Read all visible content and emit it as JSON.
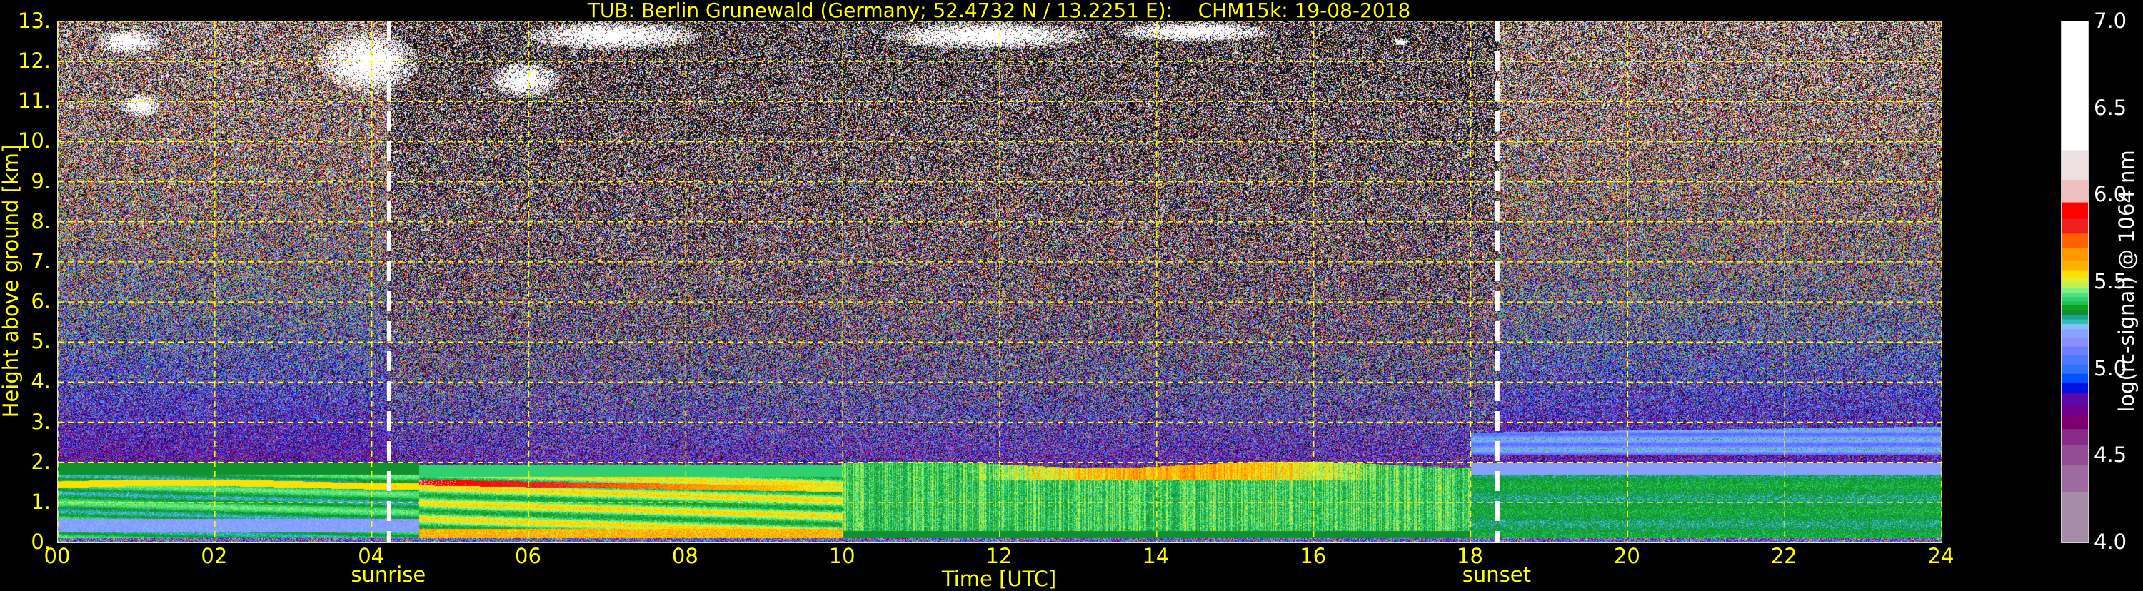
{
  "title": "TUB: Berlin Grunewald (Germany; 52.4732 N / 13.2251 E):    CHM15k: 19-08-2018",
  "chart_data": {
    "type": "heatmap",
    "title": "TUB: Berlin Grunewald (Germany; 52.4732 N / 13.2251 E):    CHM15k: 19-08-2018",
    "xlabel": "Time [UTC]",
    "ylabel": "Height above ground [km]",
    "xlim": [
      0,
      24
    ],
    "ylim": [
      0,
      13
    ],
    "xticks": [
      0,
      2,
      4,
      6,
      8,
      10,
      12,
      14,
      16,
      18,
      20,
      22,
      24
    ],
    "xtick_labels": [
      "00",
      "02",
      "04",
      "06",
      "08",
      "10",
      "12",
      "14",
      "16",
      "18",
      "20",
      "22",
      "24"
    ],
    "yticks": [
      0,
      1,
      2,
      3,
      4,
      5,
      6,
      7,
      8,
      9,
      10,
      11,
      12,
      13
    ],
    "ytick_labels": [
      "0.",
      "1.",
      "2.",
      "3.",
      "4.",
      "5.",
      "6.",
      "7.",
      "8.",
      "9.",
      "10.",
      "11.",
      "12.",
      "13."
    ],
    "grid": true,
    "annotations": [
      {
        "label": "sunrise",
        "time": 4.22
      },
      {
        "label": "sunset",
        "time": 18.34
      }
    ],
    "cirrus_patches": [
      {
        "t": [
          0.5,
          1.3
        ],
        "h": [
          12.2,
          12.8
        ]
      },
      {
        "t": [
          0.8,
          1.3
        ],
        "h": [
          10.6,
          11.2
        ]
      },
      {
        "t": [
          3.3,
          4.6
        ],
        "h": [
          11.2,
          12.8
        ]
      },
      {
        "t": [
          5.5,
          6.4
        ],
        "h": [
          11.1,
          12.0
        ]
      },
      {
        "t": [
          5.9,
          8.2
        ],
        "h": [
          12.3,
          13.0
        ]
      },
      {
        "t": [
          10.5,
          13.2
        ],
        "h": [
          12.3,
          13.0
        ]
      },
      {
        "t": [
          13.5,
          15.5
        ],
        "h": [
          12.5,
          13.0
        ]
      },
      {
        "t": [
          17.0,
          17.2
        ],
        "h": [
          12.4,
          12.6
        ]
      }
    ],
    "colorbar": {
      "label": "log(rc-signal) @ 1064 nm",
      "range": [
        4.0,
        7.0
      ],
      "ticks": [
        "4.0",
        "4.5",
        "5.0",
        "5.5",
        "6.0",
        "6.5",
        "7.0"
      ],
      "bounds": [
        4.0,
        4.29,
        4.445,
        4.564,
        4.655,
        4.733,
        4.795,
        4.86,
        4.923,
        4.973,
        5.027,
        5.08,
        5.13,
        5.18,
        5.23,
        5.26,
        5.286,
        5.31,
        5.34,
        5.37,
        5.39,
        5.416,
        5.44,
        5.465,
        5.5,
        5.53,
        5.57,
        5.625,
        5.697,
        5.78,
        5.865,
        5.96,
        6.09,
        6.26,
        7.0
      ],
      "colors": [
        "#a78ca8",
        "#9e6ba0",
        "#944c94",
        "#882a88",
        "#7c0070",
        "#700090",
        "#5a0aa8",
        "#0010e0",
        "#0050ff",
        "#3070ff",
        "#5078ff",
        "#6c80ff",
        "#8c90ff",
        "#88a0ff",
        "#80c0ff",
        "#30c0b0",
        "#20a090",
        "#109030",
        "#10a020",
        "#20c050",
        "#30d070",
        "#50e080",
        "#80f080",
        "#c0f050",
        "#e0f030",
        "#ffe000",
        "#ffb000",
        "#ff9800",
        "#ff6000",
        "#f02020",
        "#ff0000",
        "#f0c0c0",
        "#ede0e0",
        "#ffffff"
      ]
    }
  }
}
